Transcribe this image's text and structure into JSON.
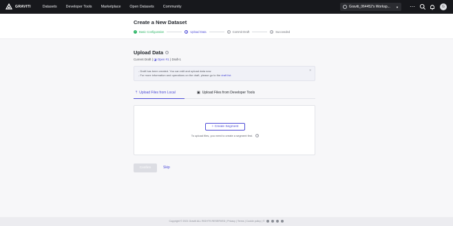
{
  "topbar": {
    "brand": "GRAVITI",
    "nav": [
      "Datasets",
      "Developer Tools",
      "Marketplace",
      "Open Datasets",
      "Community"
    ],
    "workspace": "Graviti_064452's Worksp...",
    "avatar": "G"
  },
  "header": {
    "title": "Create a New Dataset",
    "steps": [
      {
        "label": "Basic Configuration",
        "marker": "✓",
        "state": "done"
      },
      {
        "label": "Upload Data",
        "marker": "2",
        "state": "active"
      },
      {
        "label": "Commit Draft",
        "marker": "3",
        "state": "todo"
      },
      {
        "label": "Succeeded",
        "marker": "4",
        "state": "todo"
      }
    ]
  },
  "main": {
    "section_title": "Upload Data",
    "draft": {
      "prefix": "Current Draft (",
      "open_label": "Open #1",
      "suffix": ") Draft-1"
    },
    "notice": {
      "line1": "- Draft has been created. You can edit and upload data now.",
      "line2_prefix": "- For more information and operations on the draft, please go to the ",
      "line2_link": "draft list."
    },
    "tabs": [
      {
        "label": "Upload Files from Local",
        "icon": "upload-icon"
      },
      {
        "label": "Upload Files from Developer Tools",
        "icon": "terminal-icon"
      }
    ],
    "create_segment": "+ Create Segment",
    "hint": "To upload files, you need to create a segment first.",
    "confirm": "Confirm",
    "skip": "Skip"
  },
  "footer": {
    "text": "Copyright © 2021 Graviti ALL RIGHTS RESERVED | Privacy | Terms | Cookie policy | ©"
  },
  "colors": {
    "accent": "#4b4ad6",
    "success": "#28b463",
    "topbar": "#17181c"
  }
}
